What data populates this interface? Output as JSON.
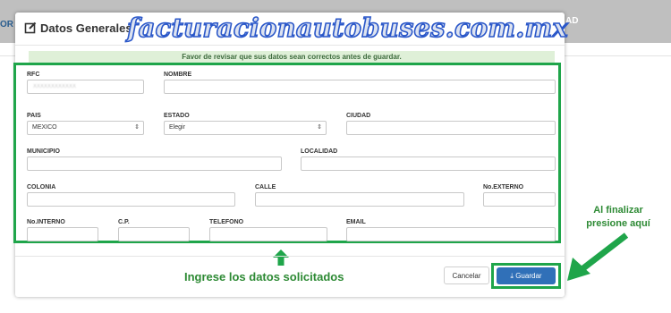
{
  "background": {
    "left_fragment": "OR",
    "right_fragment": "AD"
  },
  "modal": {
    "title": "Datos Generales",
    "title_icon": "edit-icon",
    "notice": "Favor de revisar que sus datos sean correctos antes de guardar.",
    "fields": {
      "rfc": {
        "label": "RFC",
        "value": "XXXXXXXXXXXX"
      },
      "nombre": {
        "label": "NOMBRE",
        "value": ""
      },
      "pais": {
        "label": "PAIS",
        "value": "MEXICO"
      },
      "estado": {
        "label": "ESTADO",
        "value": "Elegir"
      },
      "ciudad": {
        "label": "CIUDAD",
        "value": ""
      },
      "municipio": {
        "label": "MUNICIPIO",
        "value": ""
      },
      "localidad": {
        "label": "LOCALIDAD",
        "value": ""
      },
      "colonia": {
        "label": "COLONIA",
        "value": ""
      },
      "calle": {
        "label": "CALLE",
        "value": ""
      },
      "no_externo": {
        "label": "No.EXTERNO",
        "value": ""
      },
      "no_interno": {
        "label": "No.INTERNO",
        "value": ""
      },
      "cp": {
        "label": "C.P.",
        "value": ""
      },
      "telefono": {
        "label": "TELEFONO",
        "value": ""
      },
      "email": {
        "label": "EMAIL",
        "value": ""
      }
    },
    "buttons": {
      "cancel": "Cancelar",
      "save": "Guardar"
    }
  },
  "watermark": "facturacionautobuses.com.mx",
  "annotations": {
    "instruction": "Ingrese los datos solicitados",
    "hint_line1": "Al finalizar",
    "hint_line2": "presione aquí"
  },
  "colors": {
    "highlight_green": "#1fa54a",
    "primary_button": "#3070b8",
    "notice_bg": "#dff0d8"
  }
}
